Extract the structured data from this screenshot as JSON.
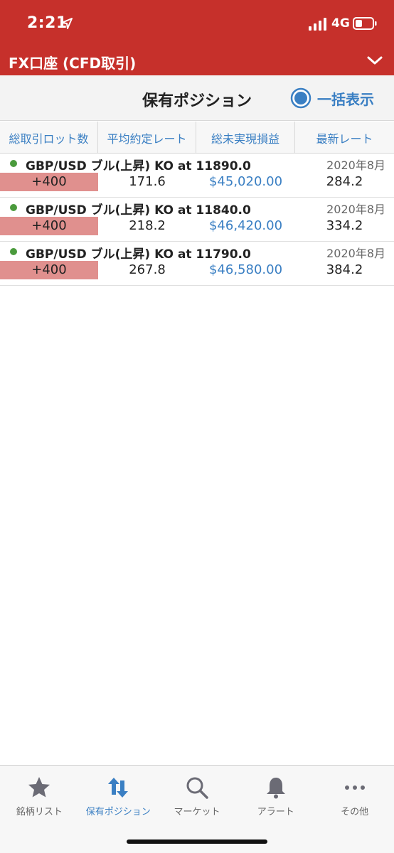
{
  "status_bar": {
    "time": "2:21",
    "network": "4G"
  },
  "account": {
    "title": "FX口座 (CFD取引)"
  },
  "header": {
    "title": "保有ポジション",
    "bulk_label": "一括表示"
  },
  "columns": [
    "総取引ロット数",
    "平均約定レート",
    "総未実現損益",
    "最新レート"
  ],
  "positions": [
    {
      "name": "GBP/USD ブル(上昇) KO at 11890.0",
      "date": "2020年8月",
      "lots": "+400",
      "avg_rate": "171.6",
      "unrealized_pl": "$45,020.00",
      "latest_rate": "284.2"
    },
    {
      "name": "GBP/USD ブル(上昇) KO at 11840.0",
      "date": "2020年8月",
      "lots": "+400",
      "avg_rate": "218.2",
      "unrealized_pl": "$46,420.00",
      "latest_rate": "334.2"
    },
    {
      "name": "GBP/USD ブル(上昇) KO at 11790.0",
      "date": "2020年8月",
      "lots": "+400",
      "avg_rate": "267.8",
      "unrealized_pl": "$46,580.00",
      "latest_rate": "384.2"
    }
  ],
  "tabs": [
    {
      "label": "銘柄リスト",
      "icon": "star-icon"
    },
    {
      "label": "保有ポジション",
      "icon": "up-down-arrows-icon"
    },
    {
      "label": "マーケット",
      "icon": "search-icon"
    },
    {
      "label": "アラート",
      "icon": "bell-icon"
    },
    {
      "label": "その他",
      "icon": "more-icon"
    }
  ],
  "colors": {
    "brand_red": "#c6302b",
    "accent_blue": "#3a7fc3",
    "lots_bg": "#e0908e",
    "dot_green": "#4a9a3c"
  }
}
